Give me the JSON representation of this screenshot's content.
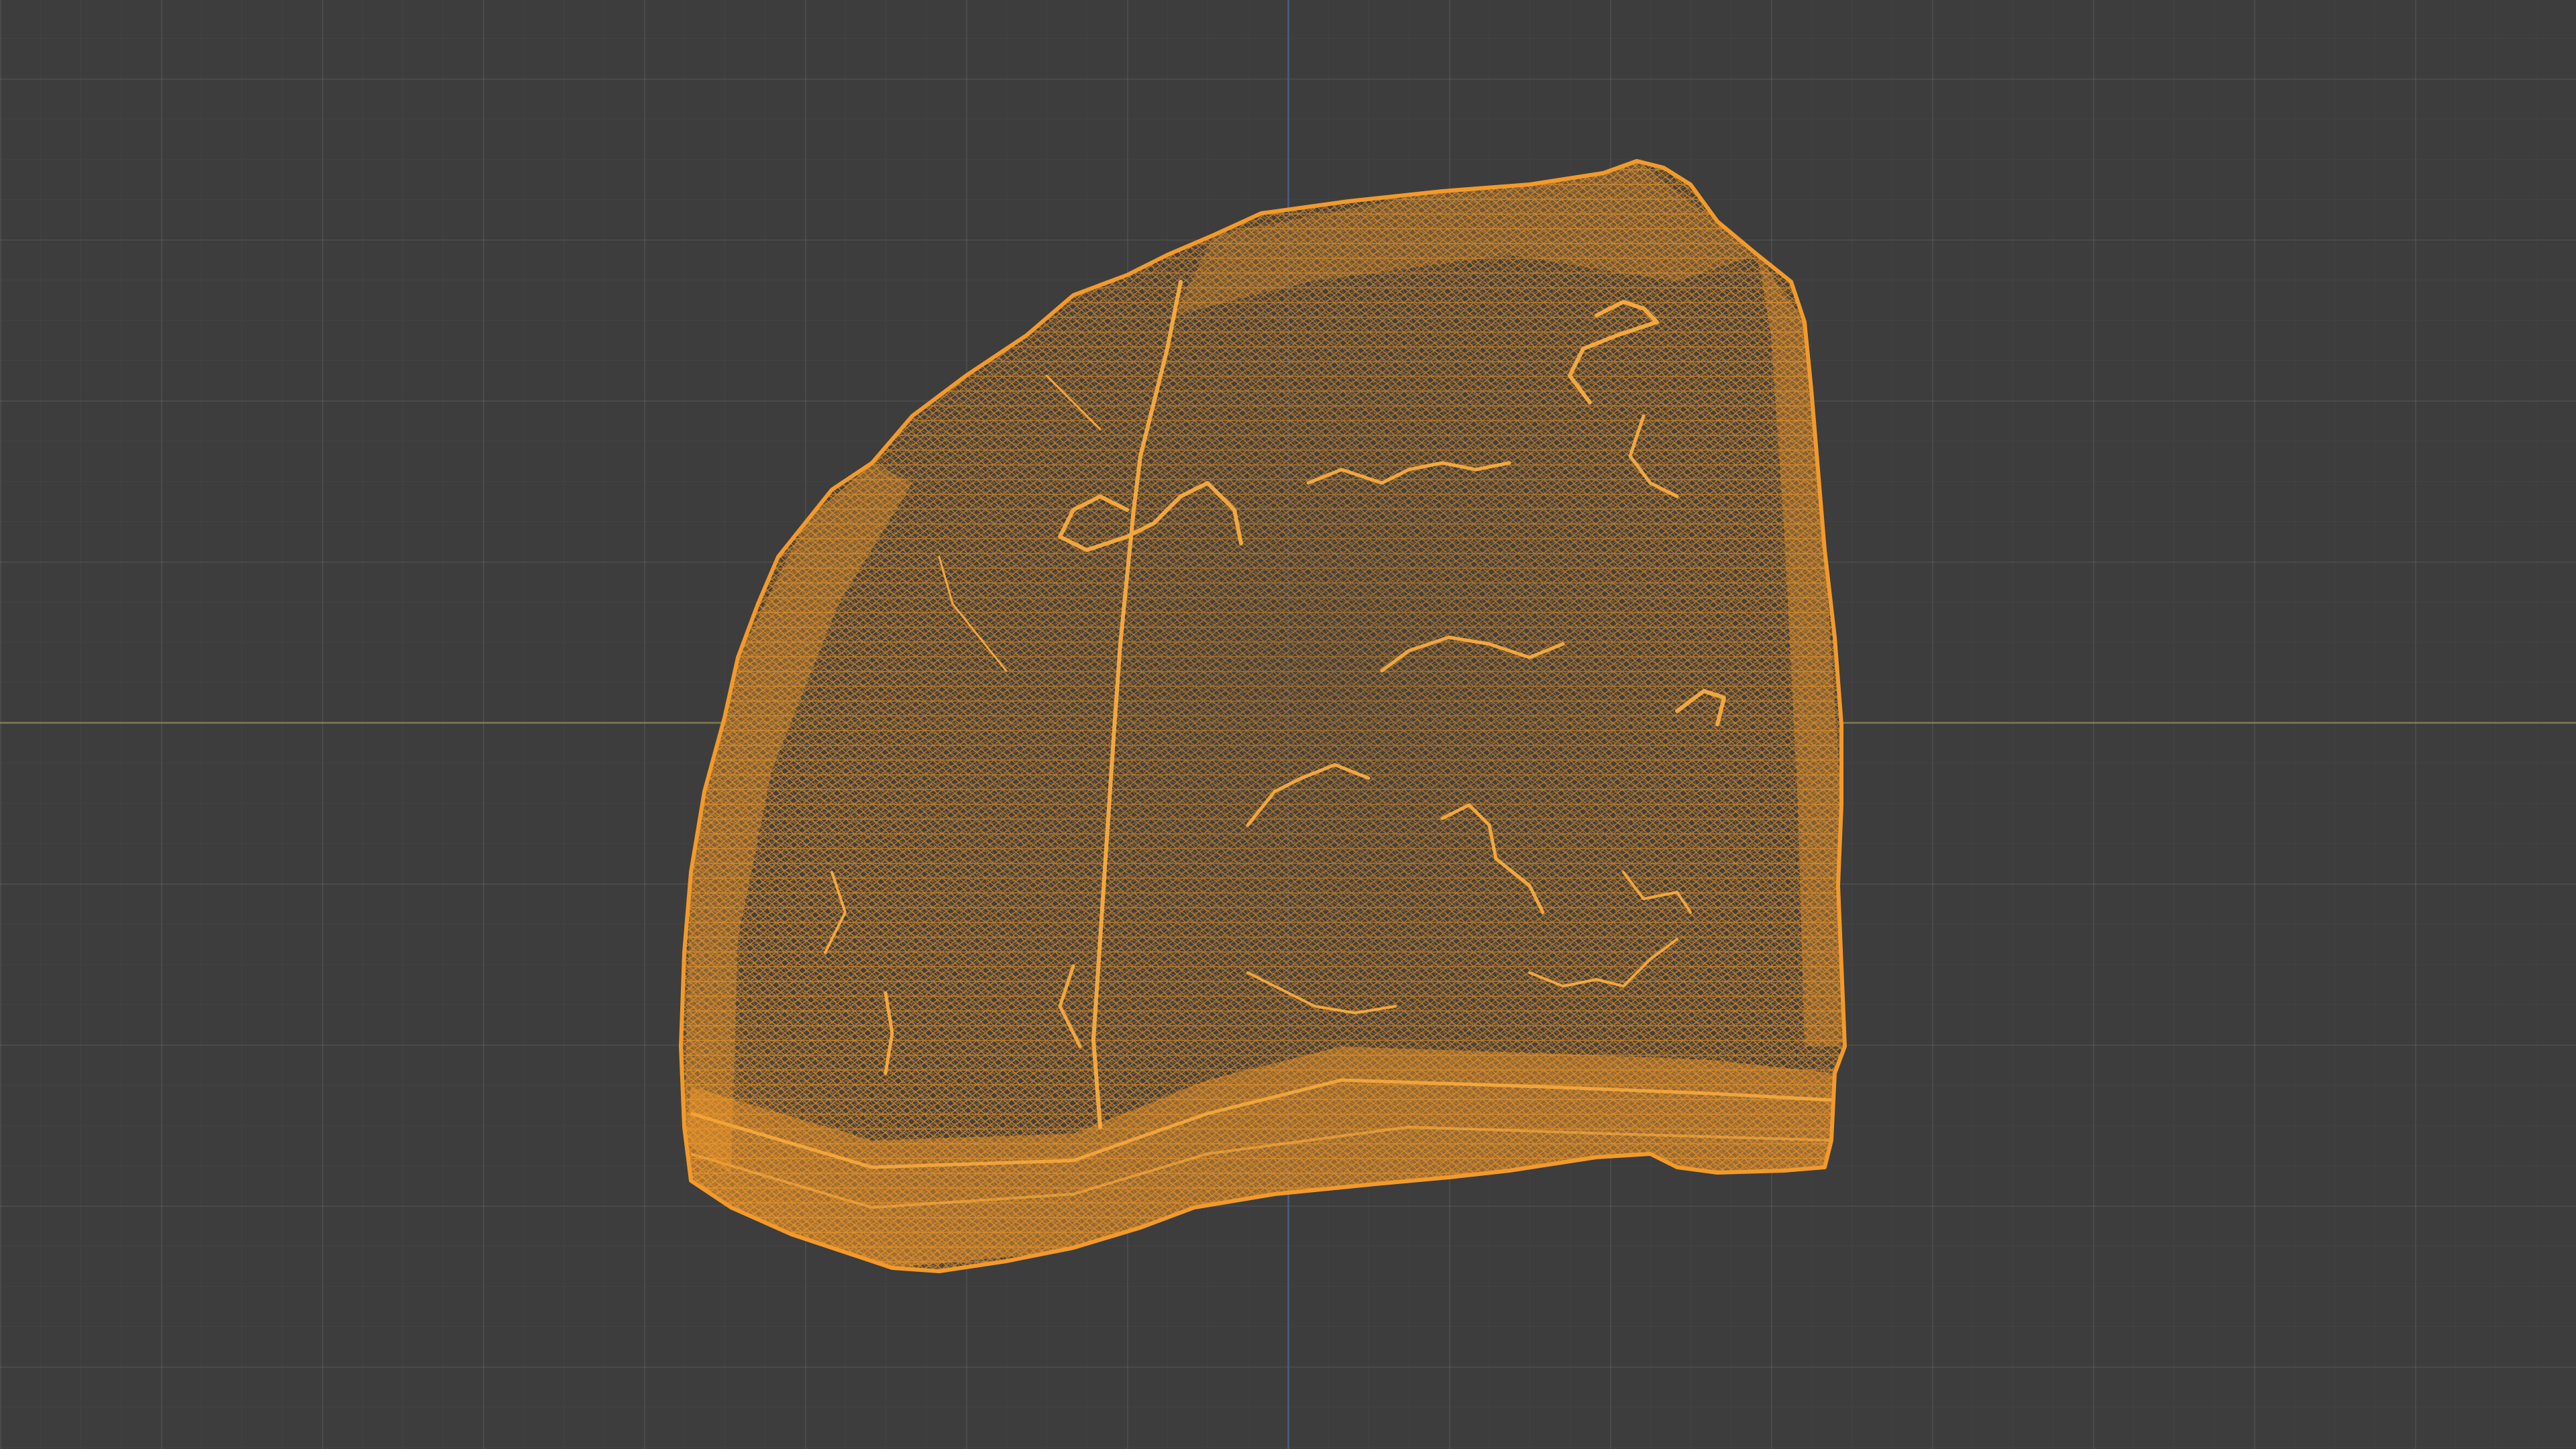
{
  "viewport": {
    "background": "#3d3d3d",
    "grid_visible": true,
    "axis_x_color": "#a09650",
    "axis_y_color": "#465f96"
  },
  "object": {
    "kind": "rock-mesh",
    "display": "wireframe",
    "selected": true,
    "wire_color": "#f39a2a",
    "highlight_color": "#ffb040"
  }
}
